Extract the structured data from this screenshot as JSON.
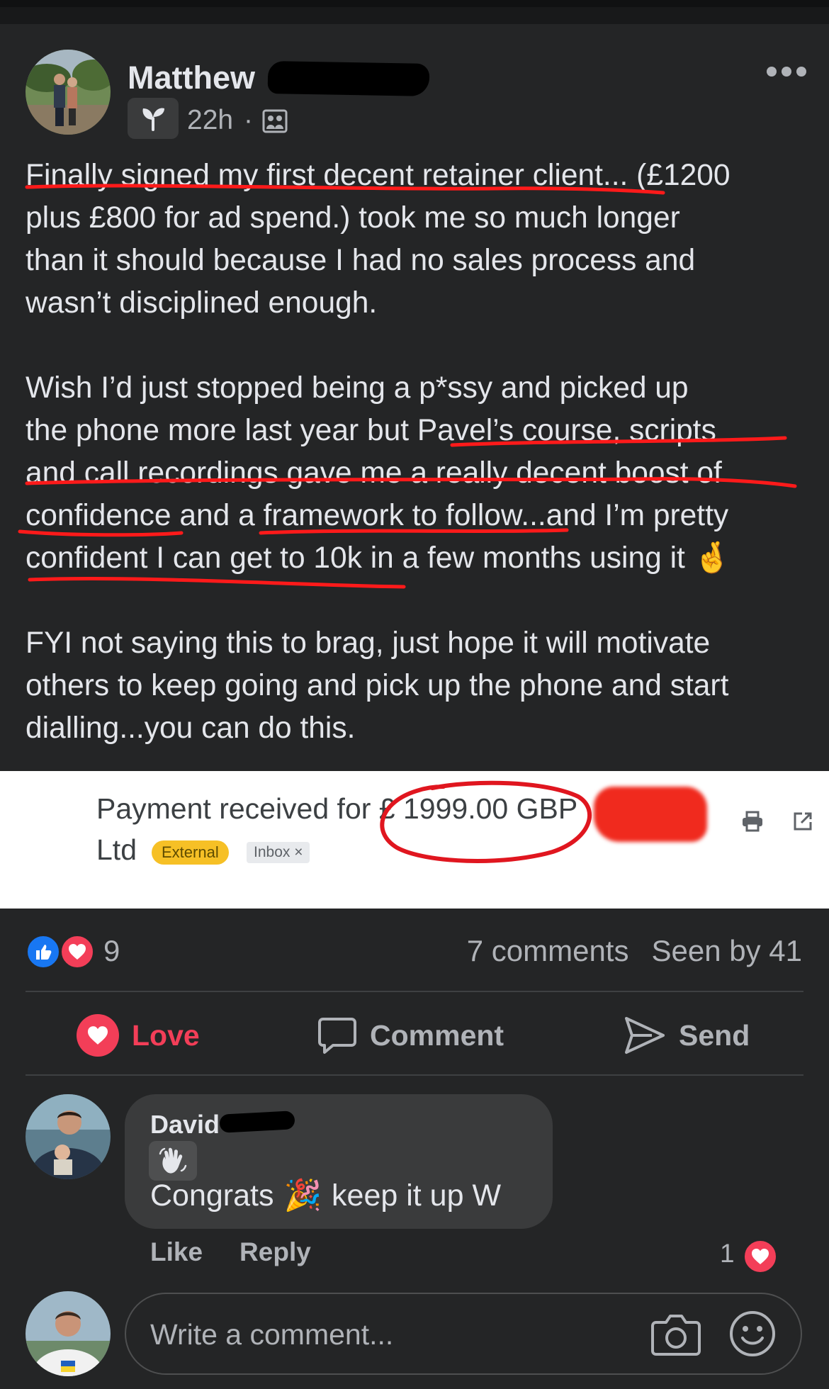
{
  "post": {
    "author_name": "Matthew",
    "time": "22h",
    "separator": "·",
    "text_blocks": [
      [
        "Finally signed my first decent retainer client... (£1200",
        "plus £800 for ad spend.) took me so much longer",
        "than it should because I had no sales process and",
        "wasn’t disciplined enough."
      ],
      [
        "Wish I’d just stopped being a p*ssy and picked up",
        "the phone more last year but Pavel’s course, scripts",
        "and call recordings gave me a really decent boost of",
        "confidence and a framework to follow...and I’m pretty",
        "confident I can get to 10k in a few months using it 🤞"
      ],
      [
        "FYI not saying this to brag, just hope it will motivate",
        "others to keep going and pick up the phone and start",
        "dialling...you can do this."
      ]
    ]
  },
  "email_image": {
    "subject": "Payment received for £ 1999.00 GBP",
    "company": "Ltd",
    "label_external": "External",
    "label_inbox": "Inbox ×",
    "highlight_color": "#e0161f"
  },
  "stats": {
    "reaction_count": "9",
    "comments": "7 comments",
    "seen_by": "Seen by 41"
  },
  "actions": {
    "love": "Love",
    "comment": "Comment",
    "send": "Send"
  },
  "comment": {
    "author_name": "David",
    "text_before": "Congrats",
    "text_after": "keep it up W",
    "emoji": "🎉",
    "like": "Like",
    "reply": "Reply",
    "reaction_count": "1"
  },
  "composer": {
    "placeholder": "Write a comment..."
  },
  "colors": {
    "background": "#242526",
    "love_red": "#f33e58",
    "like_blue": "#1877f2",
    "secondary_text": "#b0b3b8"
  }
}
